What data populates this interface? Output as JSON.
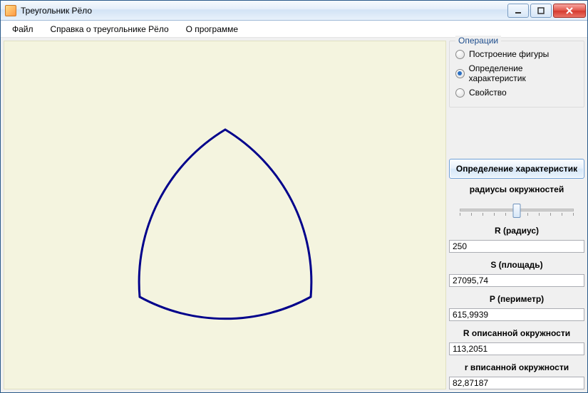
{
  "window": {
    "title": "Треугольник Рёло"
  },
  "menu": {
    "file": "Файл",
    "help": "Справка о треугольнике Рёло",
    "about": "О программе"
  },
  "operations": {
    "legend": "Операции",
    "items": [
      {
        "label": "Построение фигуры",
        "checked": false
      },
      {
        "label": "Определение характеристик",
        "checked": true
      },
      {
        "label": "Свойство",
        "checked": false
      }
    ]
  },
  "action_button": "Определение характеристик",
  "slider_label": "радиусы окружностей",
  "fields": {
    "radius": {
      "label": "R (радиус)",
      "value": "250"
    },
    "area": {
      "label": "S (площадь)",
      "value": "27095,74"
    },
    "perim": {
      "label": "P (периметр)",
      "value": "615,9939"
    },
    "circum": {
      "label": "R описанной окружности",
      "value": "113,2051"
    },
    "inscribed": {
      "label": "r вписанной окружности",
      "value": "82,87187"
    }
  },
  "shape": {
    "stroke": "#00008b"
  }
}
